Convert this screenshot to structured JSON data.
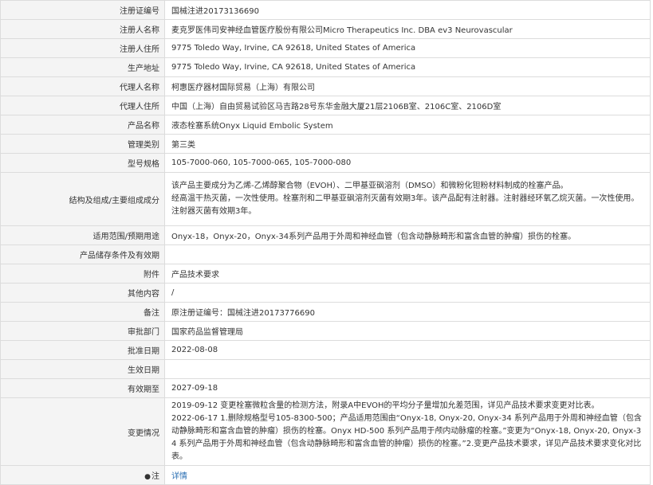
{
  "rows": [
    {
      "label": "注册证编号",
      "value": "国械注进20173136690"
    },
    {
      "label": "注册人名称",
      "value": "麦克罗医伟司安神经血管医疗股份有限公司Micro Therapeutics Inc. DBA ev3 Neurovascular"
    },
    {
      "label": "注册人住所",
      "value": "9775 Toledo Way, Irvine, CA 92618, United States of America"
    },
    {
      "label": "生产地址",
      "value": "9775 Toledo Way, Irvine, CA 92618, United States of America"
    },
    {
      "label": "代理人名称",
      "value": "柯惠医疗器材国际贸易（上海）有限公司"
    },
    {
      "label": "代理人住所",
      "value": "中国（上海）自由贸易试验区马吉路28号东华金融大厦21层2106B室、2106C室、2106D室"
    },
    {
      "label": "产品名称",
      "value": "液态栓塞系统Onyx Liquid Embolic System"
    },
    {
      "label": "管理类别",
      "value": "第三类"
    },
    {
      "label": "型号规格",
      "value": "105-7000-060, 105-7000-065, 105-7000-080"
    },
    {
      "label": "结构及组成/主要组成成分",
      "lines": [
        "该产品主要成分为乙烯-乙烯醇聚合物（EVOH）、二甲基亚砜溶剂（DMSO）和微粉化钽粉材料制成的栓塞产品。",
        "经高温干热灭菌，一次性使用。栓塞剂和二甲基亚砜溶剂灭菌有效期3年。该产品配有注射器。注射器经环氧乙烷灭菌。一次性使用。",
        "注射器灭菌有效期3年。"
      ]
    },
    {
      "label": "适用范围/预期用途",
      "value": "Onyx-18，Onyx-20，Onyx-34系列产品用于外周和神经血管（包含动静脉畸形和富含血管的肿瘤）损伤的栓塞。"
    },
    {
      "label": "产品储存条件及有效期",
      "value": ""
    },
    {
      "label": "附件",
      "value": "产品技术要求"
    },
    {
      "label": "其他内容",
      "value": "/"
    },
    {
      "label": "备注",
      "value": "原注册证编号：国械注进20173776690"
    },
    {
      "label": "审批部门",
      "value": "国家药品监督管理局"
    },
    {
      "label": "批准日期",
      "value": "2022-08-08"
    },
    {
      "label": "生效日期",
      "value": ""
    },
    {
      "label": "有效期至",
      "value": "2027-09-18"
    },
    {
      "label": "变更情况",
      "lines": [
        "2019-09-12 变更栓塞微粒含量的检测方法，附录A中EVOH的平均分子量增加允差范围，详见产品技术要求变更对比表。",
        "2022-06-17 1.删除规格型号105-8300-500；产品适用范围由“Onyx-18, Onyx-20, Onyx-34 系列产品用于外周和神经血管（包含",
        "动静脉畸形和富含血管的肿瘤）损伤的栓塞。Onyx HD-500 系列产品用于颅内动脉瘤的栓塞。”变更为“Onyx-18, Onyx-20, Onyx-3",
        "4 系列产品用于外周和神经血管（包含动静脉畸形和富含血管的肿瘤）损伤的栓塞。”2.变更产品技术要求，详见产品技术要求变化对比",
        "表。"
      ]
    }
  ],
  "footer": {
    "pin_icon": "pin-icon",
    "label": "注",
    "link": "详情"
  }
}
